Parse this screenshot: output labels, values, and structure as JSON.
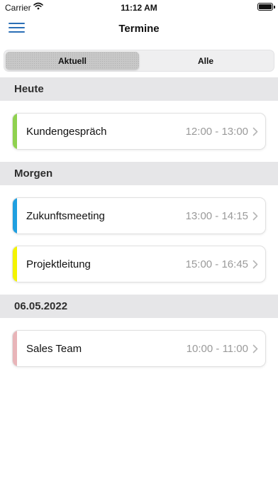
{
  "status_bar": {
    "carrier": "Carrier",
    "time": "11:12 AM"
  },
  "nav": {
    "title": "Termine"
  },
  "tabs": [
    {
      "label": "Aktuell",
      "active": true
    },
    {
      "label": "Alle",
      "active": false
    }
  ],
  "sections": [
    {
      "header": "Heute",
      "events": [
        {
          "title": "Kundengespräch",
          "time": "12:00 - 13:00",
          "color": "#8fd14f"
        }
      ]
    },
    {
      "header": "Morgen",
      "events": [
        {
          "title": "Zukunftsmeeting",
          "time": "13:00 - 14:15",
          "color": "#1f9fe0"
        },
        {
          "title": "Projektleitung",
          "time": "15:00 - 16:45",
          "color": "#f4f400"
        }
      ]
    },
    {
      "header": "06.05.2022",
      "events": [
        {
          "title": "Sales Team",
          "time": "10:00 - 11:00",
          "color": "#e8b4b8"
        }
      ]
    }
  ],
  "icons": {
    "menu": "hamburger-menu-icon",
    "chevron": "chevron-right-icon",
    "wifi": "wifi-icon",
    "battery": "battery-icon"
  },
  "colors": {
    "accent": "#2b6fb6",
    "section_bg": "#e6e6e8",
    "time_text": "#9a9a9a"
  }
}
